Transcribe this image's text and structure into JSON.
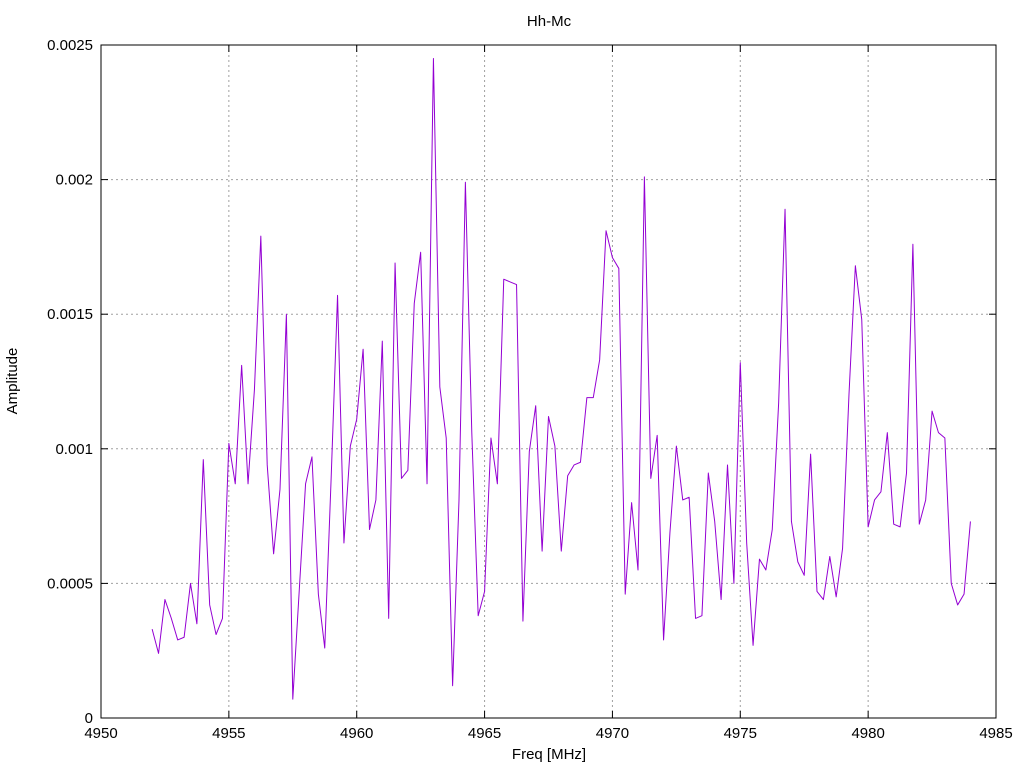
{
  "chart_data": {
    "type": "line",
    "title": "Hh-Mc",
    "xlabel": "Freq [MHz]",
    "ylabel": "Amplitude",
    "xlim": [
      4950,
      4985
    ],
    "ylim": [
      0,
      0.0025
    ],
    "xticks": [
      4950,
      4955,
      4960,
      4965,
      4970,
      4975,
      4980,
      4985
    ],
    "xtick_labels": [
      "4950",
      "4955",
      "4960",
      "4965",
      "4970",
      "4975",
      "4980",
      "4985"
    ],
    "yticks": [
      0,
      0.0005,
      0.001,
      0.0015,
      0.002,
      0.0025
    ],
    "ytick_labels": [
      "0",
      "0.0005",
      "0.001",
      "0.0015",
      "0.002",
      "0.0025"
    ],
    "grid": true,
    "legend": "none",
    "series_color": "#9400d3",
    "series": [
      {
        "x": [
          4952.0,
          4952.25,
          4952.5,
          4952.75,
          4953.0,
          4953.25,
          4953.5,
          4953.75,
          4954.0,
          4954.25,
          4954.5,
          4954.75,
          4955.0,
          4955.25,
          4955.5,
          4955.75,
          4956.0,
          4956.25,
          4956.5,
          4956.75,
          4957.0,
          4957.25,
          4957.5,
          4957.75,
          4958.0,
          4958.25,
          4958.5,
          4958.75,
          4959.0,
          4959.25,
          4959.5,
          4959.75,
          4960.0,
          4960.25,
          4960.5,
          4960.75,
          4961.0,
          4961.25,
          4961.5,
          4961.75,
          4962.0,
          4962.25,
          4962.5,
          4962.75,
          4963.0,
          4963.25,
          4963.5,
          4963.75,
          4964.0,
          4964.25,
          4964.5,
          4964.75,
          4965.0,
          4965.25,
          4965.5,
          4965.75,
          4966.0,
          4966.25,
          4966.5,
          4966.75,
          4967.0,
          4967.25,
          4967.5,
          4967.75,
          4968.0,
          4968.25,
          4968.5,
          4968.75,
          4969.0,
          4969.25,
          4969.5,
          4969.75,
          4970.0,
          4970.25,
          4970.5,
          4970.75,
          4971.0,
          4971.25,
          4971.5,
          4971.75,
          4972.0,
          4972.25,
          4972.5,
          4972.75,
          4973.0,
          4973.25,
          4973.5,
          4973.75,
          4974.0,
          4974.25,
          4974.5,
          4974.75,
          4975.0,
          4975.25,
          4975.5,
          4975.75,
          4976.0,
          4976.25,
          4976.5,
          4976.75,
          4977.0,
          4977.25,
          4977.5,
          4977.75,
          4978.0,
          4978.25,
          4978.5,
          4978.75,
          4979.0,
          4979.25,
          4979.5,
          4979.75,
          4980.0,
          4980.25,
          4980.5,
          4980.75,
          4981.0,
          4981.25,
          4981.5,
          4981.75,
          4982.0,
          4982.25,
          4982.5,
          4982.75,
          4983.0,
          4983.25,
          4983.5,
          4983.75,
          4984.0
        ],
        "y": [
          0.00033,
          0.00024,
          0.00044,
          0.00037,
          0.00029,
          0.0003,
          0.0005,
          0.00035,
          0.00096,
          0.00042,
          0.00031,
          0.00037,
          0.00102,
          0.00087,
          0.00131,
          0.00087,
          0.00122,
          0.00179,
          0.00094,
          0.00061,
          0.00085,
          0.0015,
          7e-05,
          0.00047,
          0.00087,
          0.00097,
          0.00046,
          0.00026,
          0.00089,
          0.00157,
          0.00065,
          0.00101,
          0.00111,
          0.00137,
          0.0007,
          0.00081,
          0.0014,
          0.00037,
          0.00169,
          0.00089,
          0.00092,
          0.00154,
          0.00173,
          0.00087,
          0.00245,
          0.00123,
          0.00104,
          0.00012,
          0.00081,
          0.00199,
          0.00106,
          0.00038,
          0.00047,
          0.00104,
          0.00087,
          0.00163,
          0.00162,
          0.00161,
          0.00036,
          0.00099,
          0.00116,
          0.00062,
          0.00112,
          0.00101,
          0.00062,
          0.0009,
          0.00094,
          0.00095,
          0.00119,
          0.00119,
          0.00133,
          0.00181,
          0.00171,
          0.00167,
          0.00046,
          0.0008,
          0.00055,
          0.00201,
          0.00089,
          0.00105,
          0.00029,
          0.00069,
          0.00101,
          0.00081,
          0.00082,
          0.00037,
          0.00038,
          0.00091,
          0.00073,
          0.00044,
          0.00094,
          0.0005,
          0.00132,
          0.00065,
          0.00027,
          0.00059,
          0.00055,
          0.0007,
          0.00117,
          0.00189,
          0.00073,
          0.00058,
          0.00053,
          0.00098,
          0.00047,
          0.00044,
          0.0006,
          0.00045,
          0.00063,
          0.0012,
          0.00168,
          0.00148,
          0.00071,
          0.00081,
          0.00084,
          0.00106,
          0.00072,
          0.00071,
          0.00091,
          0.00176,
          0.00072,
          0.00081,
          0.00114,
          0.00106,
          0.00104,
          0.0005,
          0.00042,
          0.00046,
          0.00073
        ]
      }
    ]
  }
}
